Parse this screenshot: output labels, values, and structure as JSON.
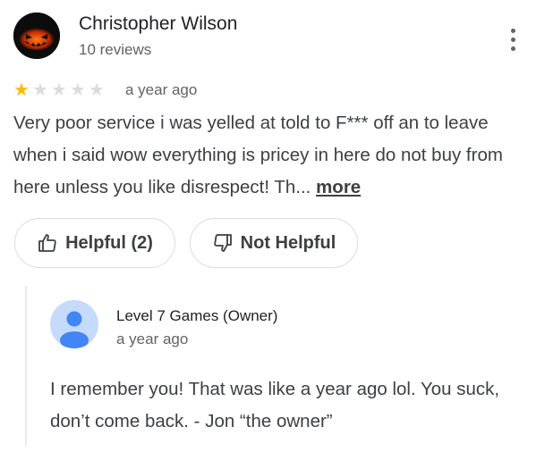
{
  "review": {
    "author_name": "Christopher Wilson",
    "review_count": "10 reviews",
    "rating": 1,
    "max_rating": 5,
    "date": "a year ago",
    "text": "Very poor service i was yelled at told to F*** off an to leave when i said wow everything is pricey in here do not buy from here unless you like disrespect! Th...",
    "more_label": "more"
  },
  "actions": {
    "helpful_label": "Helpful (2)",
    "not_helpful_label": "Not Helpful"
  },
  "owner_reply": {
    "name": "Level 7 Games (Owner)",
    "date": "a year ago",
    "text": "I remember you! That was like a year ago lol. You suck, don’t come back. - Jon “the owner”"
  },
  "icons": {
    "menu": "more-vert-icon",
    "helpful": "thumb-up-icon",
    "not_helpful": "thumb-down-icon",
    "star": "star-icon"
  },
  "colors": {
    "star_filled": "#fbbc04",
    "star_empty": "#dadce0",
    "owner_avatar_bg": "#c6dafc",
    "owner_avatar_fg": "#4285f4"
  }
}
